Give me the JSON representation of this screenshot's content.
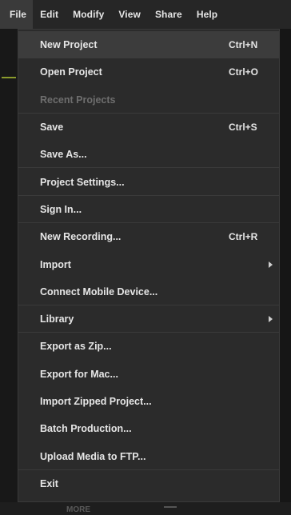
{
  "menubar": {
    "items": [
      {
        "label": "File",
        "active": true
      },
      {
        "label": "Edit"
      },
      {
        "label": "Modify"
      },
      {
        "label": "View"
      },
      {
        "label": "Share"
      },
      {
        "label": "Help"
      }
    ]
  },
  "file_menu": {
    "items": [
      {
        "label": "New Project",
        "shortcut": "Ctrl+N"
      },
      {
        "label": "Open Project",
        "shortcut": "Ctrl+O"
      },
      {
        "label": "Recent Projects",
        "disabled": true
      },
      {
        "label": "Save",
        "shortcut": "Ctrl+S"
      },
      {
        "label": "Save As..."
      },
      {
        "label": "Project Settings..."
      },
      {
        "label": "Sign In..."
      },
      {
        "label": "New Recording...",
        "shortcut": "Ctrl+R"
      },
      {
        "label": "Import",
        "submenu": true
      },
      {
        "label": "Connect Mobile Device..."
      },
      {
        "label": "Library",
        "submenu": true
      },
      {
        "label": "Export as Zip..."
      },
      {
        "label": "Export for Mac..."
      },
      {
        "label": "Import Zipped Project..."
      },
      {
        "label": "Batch Production..."
      },
      {
        "label": "Upload Media to FTP..."
      },
      {
        "label": "Exit"
      }
    ]
  },
  "background": {
    "bottom_text": "MORE"
  }
}
